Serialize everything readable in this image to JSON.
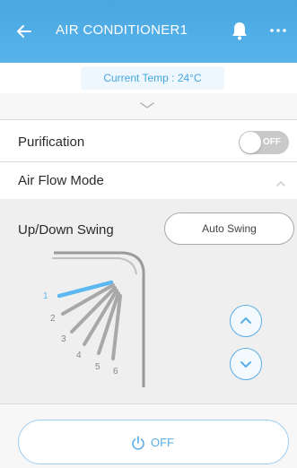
{
  "header": {
    "title": "AIR CONDITIONER1",
    "icons": [
      "back-arrow-icon",
      "bell-icon",
      "more-icon"
    ]
  },
  "temperature": {
    "text": "Current Temp : 24°C"
  },
  "purification": {
    "label": "Purification",
    "toggle_text": "OFF",
    "state": "off"
  },
  "air_flow": {
    "label": "Air Flow Mode",
    "expanded": true
  },
  "swing": {
    "label": "Up/Down Swing",
    "mode_button": "Auto Swing",
    "positions": [
      "1",
      "2",
      "3",
      "4",
      "5",
      "6"
    ],
    "selected_position": "1"
  },
  "power": {
    "label": "OFF"
  },
  "colors": {
    "accent": "#4aa7e0",
    "selected_vane": "#5bb8f0",
    "vane": "#a8a8a8"
  }
}
